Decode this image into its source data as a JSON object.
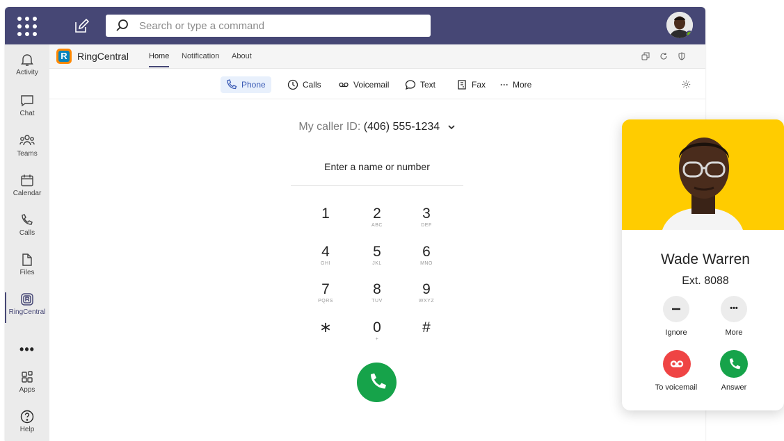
{
  "topbar": {
    "search_placeholder": "Search or type a command"
  },
  "rail": {
    "items": [
      {
        "label": "Activity",
        "icon": "bell-icon"
      },
      {
        "label": "Chat",
        "icon": "chat-icon"
      },
      {
        "label": "Teams",
        "icon": "teams-icon"
      },
      {
        "label": "Calendar",
        "icon": "calendar-icon"
      },
      {
        "label": "Calls",
        "icon": "phone-icon"
      },
      {
        "label": "Files",
        "icon": "file-icon"
      },
      {
        "label": "RingCentral",
        "icon": "ringcentral-icon"
      },
      {
        "label": "Apps",
        "icon": "apps-icon"
      },
      {
        "label": "Help",
        "icon": "help-icon"
      }
    ],
    "more": "•••"
  },
  "app": {
    "name": "RingCentral",
    "logo_letter": "R",
    "tabs": [
      "Home",
      "Notification",
      "About"
    ]
  },
  "subtabs": [
    {
      "label": "Phone",
      "icon": "phone-icon"
    },
    {
      "label": "Calls",
      "icon": "clock-icon"
    },
    {
      "label": "Voicemail",
      "icon": "voicemail-icon"
    },
    {
      "label": "Text",
      "icon": "message-icon"
    },
    {
      "label": "Fax",
      "icon": "fax-icon"
    },
    {
      "label": "More",
      "icon": "more-icon",
      "glyph": "···"
    }
  ],
  "dialer": {
    "caller_id_label": "My caller ID:",
    "caller_id_value": "(406) 555-1234",
    "entry_placeholder": "Enter a name or number",
    "keys": [
      {
        "d": "1",
        "s": ""
      },
      {
        "d": "2",
        "s": "ABC"
      },
      {
        "d": "3",
        "s": "DEF"
      },
      {
        "d": "4",
        "s": "GHI"
      },
      {
        "d": "5",
        "s": "JKL"
      },
      {
        "d": "6",
        "s": "MNO"
      },
      {
        "d": "7",
        "s": "PQRS"
      },
      {
        "d": "8",
        "s": "TUV"
      },
      {
        "d": "9",
        "s": "WXYZ"
      },
      {
        "d": "∗",
        "s": ""
      },
      {
        "d": "0",
        "s": "+"
      },
      {
        "d": "#",
        "s": ""
      }
    ]
  },
  "incoming": {
    "name": "Wade Warren",
    "ext": "Ext. 8088",
    "ignore_label": "Ignore",
    "more_label": "More",
    "more_glyph": "•••",
    "voicemail_label": "To voicemail",
    "answer_label": "Answer"
  },
  "colors": {
    "titlebar": "#464775",
    "accent_green": "#16a34a",
    "decline_red": "#ef4444",
    "card_photo_bg": "#ffcc00",
    "logo_orange": "#ff8800",
    "logo_blue": "#0684bd"
  }
}
